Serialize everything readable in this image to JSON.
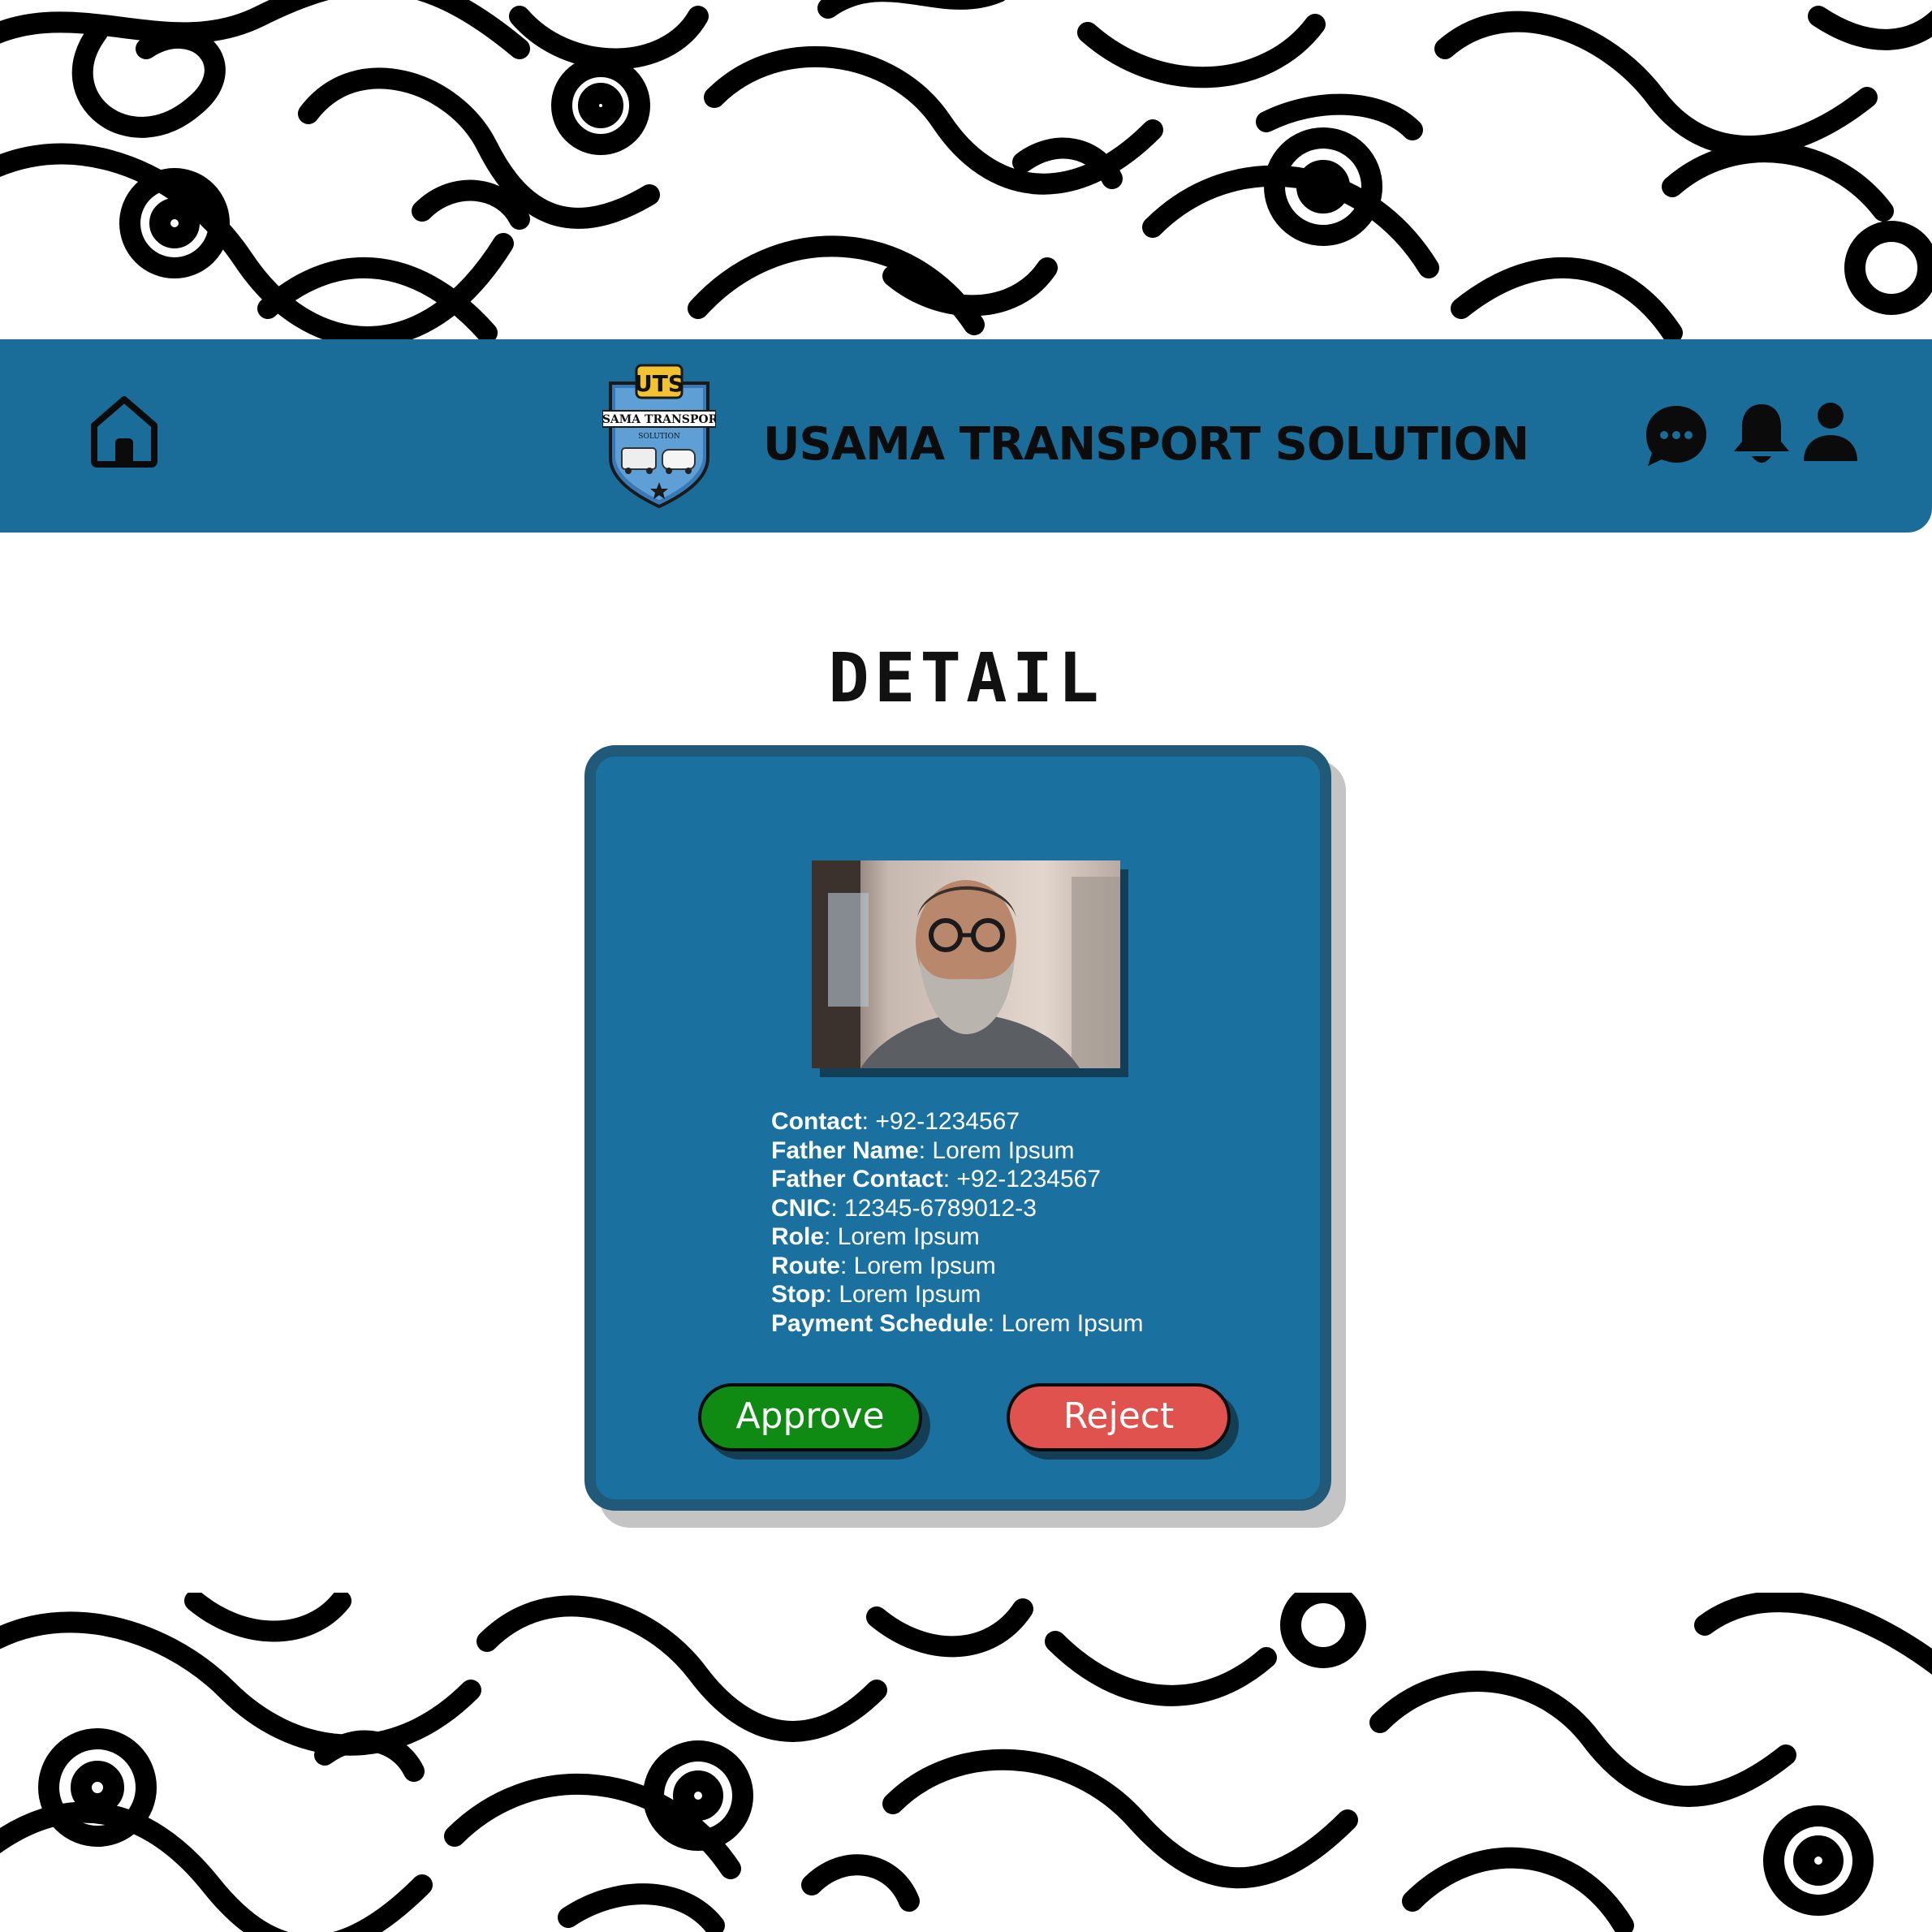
{
  "app": {
    "title": "USAMA TRANSPORT SOLUTION",
    "logo": {
      "monogram": "UTS",
      "banner": "USAMA TRANSPORT",
      "subtitle": "SOLUTION"
    }
  },
  "header": {
    "icons": [
      "home-icon",
      "chat-icon",
      "bell-icon",
      "user-icon"
    ]
  },
  "page": {
    "title": "DETAIL"
  },
  "profile": {
    "fields": [
      {
        "label": "Contact",
        "value": "+92-1234567"
      },
      {
        "label": "Father Name",
        "value": "Lorem Ipsum"
      },
      {
        "label": "Father Contact",
        "value": "+92-1234567"
      },
      {
        "label": "CNIC",
        "value": "12345-6789012-3"
      },
      {
        "label": "Role",
        "value": "Lorem Ipsum"
      },
      {
        "label": "Route",
        "value": "Lorem Ipsum"
      },
      {
        "label": "Stop",
        "value": "Lorem Ipsum"
      },
      {
        "label": "Payment Schedule",
        "value": "Lorem Ipsum"
      }
    ]
  },
  "actions": {
    "approve_label": "Approve",
    "reject_label": "Reject"
  },
  "colors": {
    "header_bg": "#1a6c99",
    "card_bg": "#1a71a0",
    "card_border": "#215a78",
    "approve": "#0f8a12",
    "reject": "#e0524e"
  }
}
